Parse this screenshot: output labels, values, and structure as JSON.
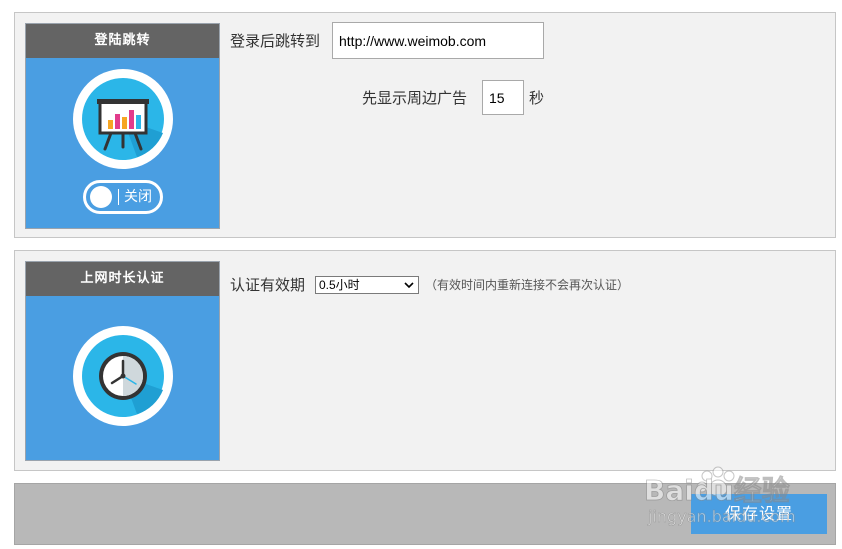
{
  "redirect_panel": {
    "card_title": "登陆跳转",
    "icon": "presentation-chart-icon",
    "toggle_label": "关闭",
    "url_label": "登录后跳转到",
    "url_value": "http://www.weimob.com",
    "ad_label": "先显示周边广告",
    "ad_seconds": "15",
    "ad_unit": "秒"
  },
  "auth_panel": {
    "card_title": "上网时长认证",
    "icon": "clock-icon",
    "validity_label": "认证有效期",
    "validity_selected": "0.5小时",
    "validity_note": "（有效时间内重新连接不会再次认证）"
  },
  "footer": {
    "save_label": "保存设置"
  },
  "watermark": {
    "brand": "Baidu经验",
    "url": "jingyan.baidu.com"
  },
  "colors": {
    "accent_blue": "#4a9ee2",
    "card_title_bg": "#646464",
    "panel_bg": "#f2f2f2",
    "footer_bg": "#b8b8b8"
  }
}
